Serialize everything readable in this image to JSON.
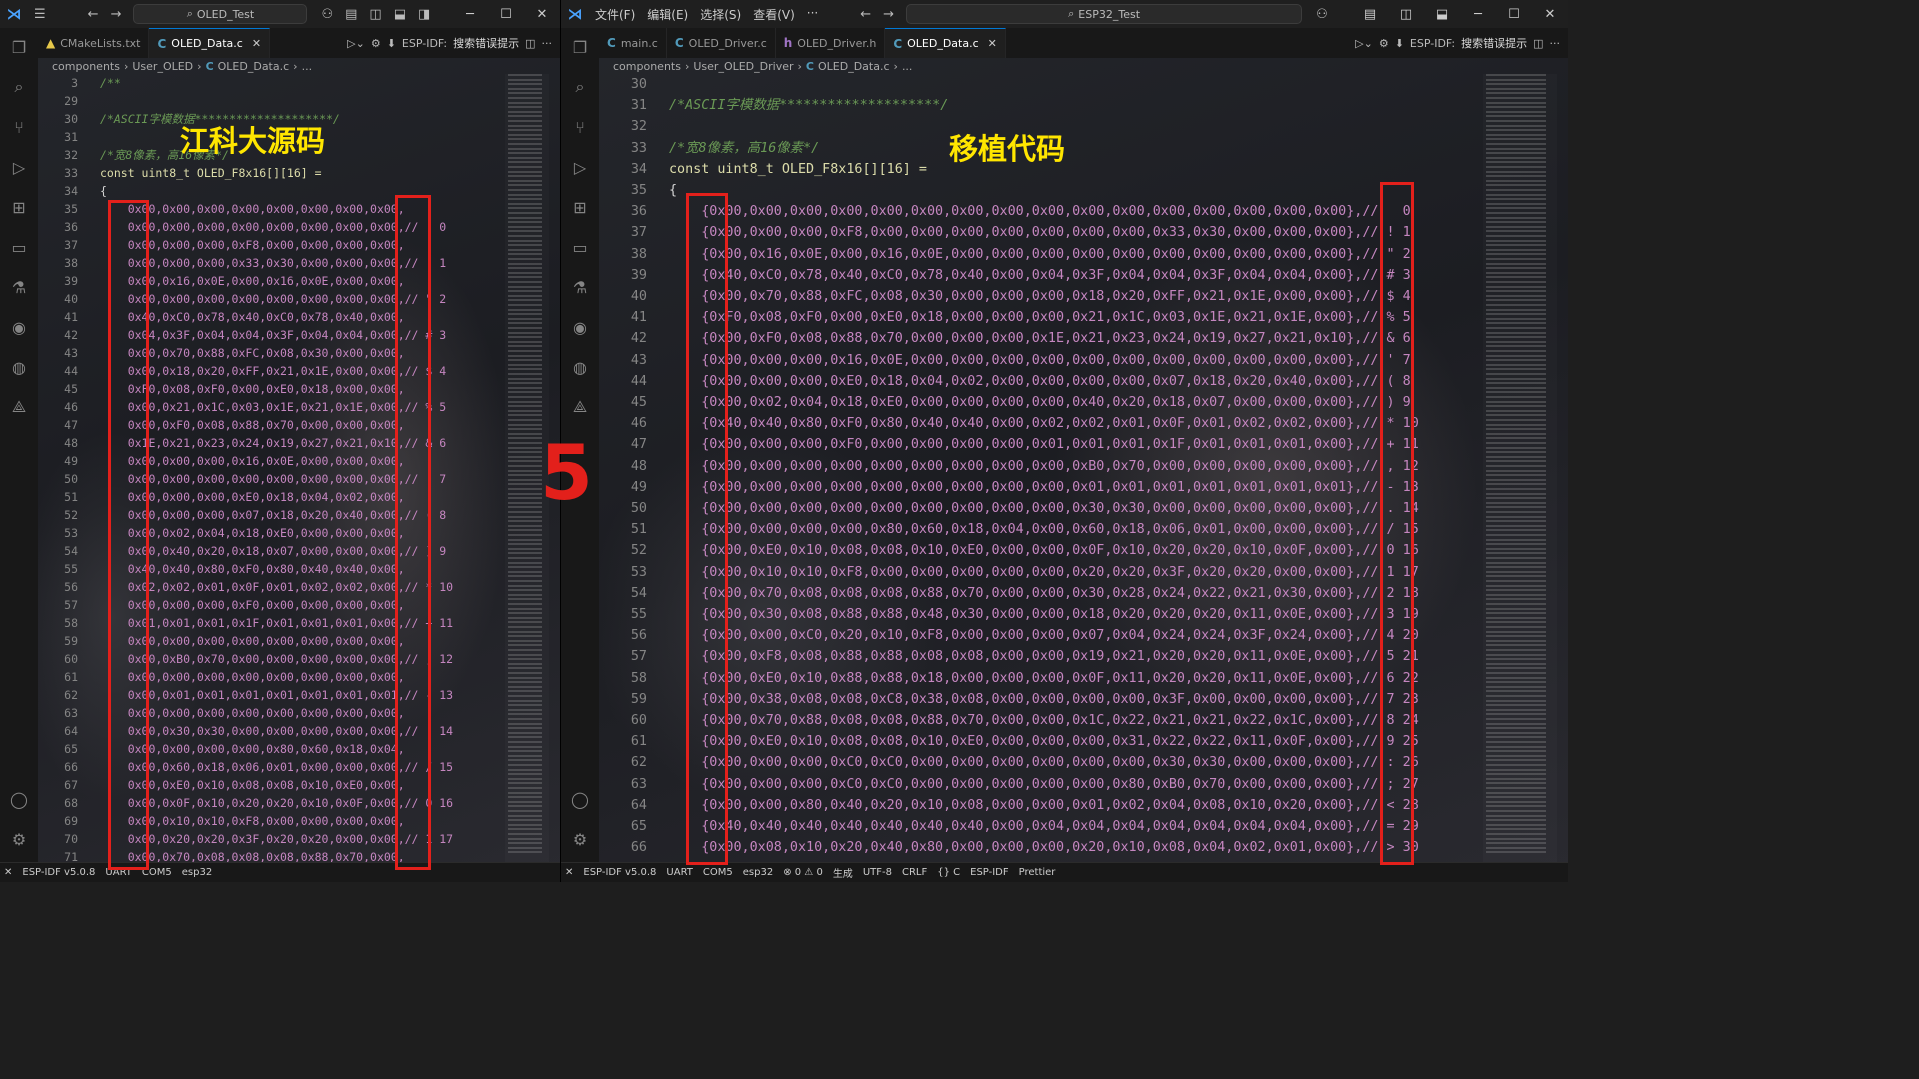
{
  "left": {
    "search": "OLED_Test",
    "tabs": [
      {
        "label": "CMakeLists.txt",
        "icon": "cmake-icon"
      },
      {
        "label": "OLED_Data.c",
        "icon": "c-file-icon",
        "active": true
      }
    ],
    "espidf": "ESP-IDF:",
    "espidf_hint": "搜索错误提示",
    "crumb": [
      "components",
      "User_OLED",
      "OLED_Data.c",
      "..."
    ],
    "annotation": "江科大源码",
    "status": [
      "ESP-IDF v5.0.8",
      "UART",
      "COM5",
      "esp32"
    ],
    "lines": [
      {
        "n": "3",
        "t": "/**",
        "k": "cm"
      },
      {
        "n": "29",
        "t": "",
        "k": "pl"
      },
      {
        "n": "30",
        "t": "/*ASCII字模数据********************/",
        "k": "cm"
      },
      {
        "n": "31",
        "t": "",
        "k": "pl"
      },
      {
        "n": "32",
        "t": "/*宽8像素，高16像素*/",
        "k": "cm"
      },
      {
        "n": "33",
        "t": "const uint8_t OLED_F8x16[][16] =",
        "k": "decl"
      },
      {
        "n": "34",
        "t": "{",
        "k": "pl"
      },
      {
        "n": "35",
        "t": "    0x00,0x00,0x00,0x00,0x00,0x00,0x00,0x00,",
        "k": "hx"
      },
      {
        "n": "36",
        "t": "    0x00,0x00,0x00,0x00,0x00,0x00,0x00,0x00,//   0",
        "k": "hx"
      },
      {
        "n": "37",
        "t": "    0x00,0x00,0x00,0xF8,0x00,0x00,0x00,0x00,",
        "k": "hx"
      },
      {
        "n": "38",
        "t": "    0x00,0x00,0x00,0x33,0x30,0x00,0x00,0x00,// ! 1",
        "k": "hx"
      },
      {
        "n": "39",
        "t": "    0x00,0x16,0x0E,0x00,0x16,0x0E,0x00,0x00,",
        "k": "hx"
      },
      {
        "n": "40",
        "t": "    0x00,0x00,0x00,0x00,0x00,0x00,0x00,0x00,// \" 2",
        "k": "hx"
      },
      {
        "n": "41",
        "t": "    0x40,0xC0,0x78,0x40,0xC0,0x78,0x40,0x00,",
        "k": "hx"
      },
      {
        "n": "42",
        "t": "    0x04,0x3F,0x04,0x04,0x3F,0x04,0x04,0x00,// # 3",
        "k": "hx"
      },
      {
        "n": "43",
        "t": "    0x00,0x70,0x88,0xFC,0x08,0x30,0x00,0x00,",
        "k": "hx"
      },
      {
        "n": "44",
        "t": "    0x00,0x18,0x20,0xFF,0x21,0x1E,0x00,0x00,// $ 4",
        "k": "hx"
      },
      {
        "n": "45",
        "t": "    0xF0,0x08,0xF0,0x00,0xE0,0x18,0x00,0x00,",
        "k": "hx"
      },
      {
        "n": "46",
        "t": "    0x00,0x21,0x1C,0x03,0x1E,0x21,0x1E,0x00,// % 5",
        "k": "hx"
      },
      {
        "n": "47",
        "t": "    0x00,0xF0,0x08,0x88,0x70,0x00,0x00,0x00,",
        "k": "hx"
      },
      {
        "n": "48",
        "t": "    0x1E,0x21,0x23,0x24,0x19,0x27,0x21,0x10,// & 6",
        "k": "hx"
      },
      {
        "n": "49",
        "t": "    0x00,0x00,0x00,0x16,0x0E,0x00,0x00,0x00,",
        "k": "hx"
      },
      {
        "n": "50",
        "t": "    0x00,0x00,0x00,0x00,0x00,0x00,0x00,0x00,// ' 7",
        "k": "hx"
      },
      {
        "n": "51",
        "t": "    0x00,0x00,0x00,0xE0,0x18,0x04,0x02,0x00,",
        "k": "hx"
      },
      {
        "n": "52",
        "t": "    0x00,0x00,0x00,0x07,0x18,0x20,0x40,0x00,// ( 8",
        "k": "hx"
      },
      {
        "n": "53",
        "t": "    0x00,0x02,0x04,0x18,0xE0,0x00,0x00,0x00,",
        "k": "hx"
      },
      {
        "n": "54",
        "t": "    0x00,0x40,0x20,0x18,0x07,0x00,0x00,0x00,// ) 9",
        "k": "hx"
      },
      {
        "n": "55",
        "t": "    0x40,0x40,0x80,0xF0,0x80,0x40,0x40,0x00,",
        "k": "hx"
      },
      {
        "n": "56",
        "t": "    0x02,0x02,0x01,0x0F,0x01,0x02,0x02,0x00,// * 10",
        "k": "hx"
      },
      {
        "n": "57",
        "t": "    0x00,0x00,0x00,0xF0,0x00,0x00,0x00,0x00,",
        "k": "hx"
      },
      {
        "n": "58",
        "t": "    0x01,0x01,0x01,0x1F,0x01,0x01,0x01,0x00,// + 11",
        "k": "hx"
      },
      {
        "n": "59",
        "t": "    0x00,0x00,0x00,0x00,0x00,0x00,0x00,0x00,",
        "k": "hx"
      },
      {
        "n": "60",
        "t": "    0x00,0xB0,0x70,0x00,0x00,0x00,0x00,0x00,// , 12",
        "k": "hx"
      },
      {
        "n": "61",
        "t": "    0x00,0x00,0x00,0x00,0x00,0x00,0x00,0x00,",
        "k": "hx"
      },
      {
        "n": "62",
        "t": "    0x00,0x01,0x01,0x01,0x01,0x01,0x01,0x01,// - 13",
        "k": "hx"
      },
      {
        "n": "63",
        "t": "    0x00,0x00,0x00,0x00,0x00,0x00,0x00,0x00,",
        "k": "hx"
      },
      {
        "n": "64",
        "t": "    0x00,0x30,0x30,0x00,0x00,0x00,0x00,0x00,// . 14",
        "k": "hx"
      },
      {
        "n": "65",
        "t": "    0x00,0x00,0x00,0x00,0x80,0x60,0x18,0x04,",
        "k": "hx"
      },
      {
        "n": "66",
        "t": "    0x00,0x60,0x18,0x06,0x01,0x00,0x00,0x00,// / 15",
        "k": "hx"
      },
      {
        "n": "67",
        "t": "    0x00,0xE0,0x10,0x08,0x08,0x10,0xE0,0x00,",
        "k": "hx"
      },
      {
        "n": "68",
        "t": "    0x00,0x0F,0x10,0x20,0x20,0x10,0x0F,0x00,// 0 16",
        "k": "hx"
      },
      {
        "n": "69",
        "t": "    0x00,0x10,0x10,0xF8,0x00,0x00,0x00,0x00,",
        "k": "hx"
      },
      {
        "n": "70",
        "t": "    0x00,0x20,0x20,0x3F,0x20,0x20,0x00,0x00,// 1 17",
        "k": "hx"
      },
      {
        "n": "71",
        "t": "    0x00,0x70,0x08,0x08,0x08,0x88,0x70,0x00,",
        "k": "hx"
      }
    ]
  },
  "right": {
    "menus": [
      "文件(F)",
      "编辑(E)",
      "选择(S)",
      "查看(V)",
      "···"
    ],
    "search": "ESP32_Test",
    "tabs": [
      {
        "label": "main.c",
        "icon": "c-file-icon"
      },
      {
        "label": "OLED_Driver.c",
        "icon": "c-file-icon"
      },
      {
        "label": "OLED_Driver.h",
        "icon": "h-file-icon"
      },
      {
        "label": "OLED_Data.c",
        "icon": "c-file-icon",
        "active": true
      }
    ],
    "espidf": "ESP-IDF:",
    "espidf_hint": "搜索错误提示",
    "crumb": [
      "components",
      "User_OLED_Driver",
      "OLED_Data.c",
      "..."
    ],
    "annotation": "移植代码",
    "status": [
      "ESP-IDF v5.0.8",
      "UART",
      "COM5",
      "esp32",
      "⊗ 0 ⚠ 0",
      "生成",
      "UTF-8",
      "CRLF",
      "{} C",
      "ESP-IDF",
      "Prettier"
    ],
    "lines": [
      {
        "n": "30",
        "t": "",
        "k": "pl"
      },
      {
        "n": "31",
        "t": "/*ASCII字模数据********************/",
        "k": "cm"
      },
      {
        "n": "32",
        "t": "",
        "k": "pl"
      },
      {
        "n": "33",
        "t": "/*宽8像素，高16像素*/",
        "k": "cm"
      },
      {
        "n": "34",
        "t": "const uint8_t OLED_F8x16[][16] =",
        "k": "decl"
      },
      {
        "n": "35",
        "t": "{",
        "k": "pl"
      },
      {
        "n": "36",
        "t": "    {0x00,0x00,0x00,0x00,0x00,0x00,0x00,0x00,0x00,0x00,0x00,0x00,0x00,0x00,0x00,0x00},//   0",
        "k": "hx"
      },
      {
        "n": "37",
        "t": "    {0x00,0x00,0x00,0xF8,0x00,0x00,0x00,0x00,0x00,0x00,0x00,0x33,0x30,0x00,0x00,0x00},// ! 1",
        "k": "hx"
      },
      {
        "n": "38",
        "t": "    {0x00,0x16,0x0E,0x00,0x16,0x0E,0x00,0x00,0x00,0x00,0x00,0x00,0x00,0x00,0x00,0x00},// \" 2",
        "k": "hx"
      },
      {
        "n": "39",
        "t": "    {0x40,0xC0,0x78,0x40,0xC0,0x78,0x40,0x00,0x04,0x3F,0x04,0x04,0x3F,0x04,0x04,0x00},// # 3",
        "k": "hx"
      },
      {
        "n": "40",
        "t": "    {0x00,0x70,0x88,0xFC,0x08,0x30,0x00,0x00,0x00,0x18,0x20,0xFF,0x21,0x1E,0x00,0x00},// $ 4",
        "k": "hx"
      },
      {
        "n": "41",
        "t": "    {0xF0,0x08,0xF0,0x00,0xE0,0x18,0x00,0x00,0x00,0x21,0x1C,0x03,0x1E,0x21,0x1E,0x00},// % 5",
        "k": "hx"
      },
      {
        "n": "42",
        "t": "    {0x00,0xF0,0x08,0x88,0x70,0x00,0x00,0x00,0x1E,0x21,0x23,0x24,0x19,0x27,0x21,0x10},// & 6",
        "k": "hx"
      },
      {
        "n": "43",
        "t": "    {0x00,0x00,0x00,0x16,0x0E,0x00,0x00,0x00,0x00,0x00,0x00,0x00,0x00,0x00,0x00,0x00},// ' 7",
        "k": "hx"
      },
      {
        "n": "44",
        "t": "    {0x00,0x00,0x00,0xE0,0x18,0x04,0x02,0x00,0x00,0x00,0x00,0x07,0x18,0x20,0x40,0x00},// ( 8",
        "k": "hx"
      },
      {
        "n": "45",
        "t": "    {0x00,0x02,0x04,0x18,0xE0,0x00,0x00,0x00,0x00,0x40,0x20,0x18,0x07,0x00,0x00,0x00},// ) 9",
        "k": "hx"
      },
      {
        "n": "46",
        "t": "    {0x40,0x40,0x80,0xF0,0x80,0x40,0x40,0x00,0x02,0x02,0x01,0x0F,0x01,0x02,0x02,0x00},// * 10",
        "k": "hx"
      },
      {
        "n": "47",
        "t": "    {0x00,0x00,0x00,0xF0,0x00,0x00,0x00,0x00,0x01,0x01,0x01,0x1F,0x01,0x01,0x01,0x00},// + 11",
        "k": "hx"
      },
      {
        "n": "48",
        "t": "    {0x00,0x00,0x00,0x00,0x00,0x00,0x00,0x00,0x00,0xB0,0x70,0x00,0x00,0x00,0x00,0x00},// , 12",
        "k": "hx"
      },
      {
        "n": "49",
        "t": "    {0x00,0x00,0x00,0x00,0x00,0x00,0x00,0x00,0x00,0x01,0x01,0x01,0x01,0x01,0x01,0x01},// - 13",
        "k": "hx"
      },
      {
        "n": "50",
        "t": "    {0x00,0x00,0x00,0x00,0x00,0x00,0x00,0x00,0x00,0x30,0x30,0x00,0x00,0x00,0x00,0x00},// . 14",
        "k": "hx"
      },
      {
        "n": "51",
        "t": "    {0x00,0x00,0x00,0x00,0x80,0x60,0x18,0x04,0x00,0x60,0x18,0x06,0x01,0x00,0x00,0x00},// / 15",
        "k": "hx"
      },
      {
        "n": "52",
        "t": "    {0x00,0xE0,0x10,0x08,0x08,0x10,0xE0,0x00,0x00,0x0F,0x10,0x20,0x20,0x10,0x0F,0x00},// 0 16",
        "k": "hx"
      },
      {
        "n": "53",
        "t": "    {0x00,0x10,0x10,0xF8,0x00,0x00,0x00,0x00,0x00,0x20,0x20,0x3F,0x20,0x20,0x00,0x00},// 1 17",
        "k": "hx"
      },
      {
        "n": "54",
        "t": "    {0x00,0x70,0x08,0x08,0x08,0x88,0x70,0x00,0x00,0x30,0x28,0x24,0x22,0x21,0x30,0x00},// 2 18",
        "k": "hx"
      },
      {
        "n": "55",
        "t": "    {0x00,0x30,0x08,0x88,0x88,0x48,0x30,0x00,0x00,0x18,0x20,0x20,0x20,0x11,0x0E,0x00},// 3 19",
        "k": "hx"
      },
      {
        "n": "56",
        "t": "    {0x00,0x00,0xC0,0x20,0x10,0xF8,0x00,0x00,0x00,0x07,0x04,0x24,0x24,0x3F,0x24,0x00},// 4 20",
        "k": "hx"
      },
      {
        "n": "57",
        "t": "    {0x00,0xF8,0x08,0x88,0x88,0x08,0x08,0x00,0x00,0x19,0x21,0x20,0x20,0x11,0x0E,0x00},// 5 21",
        "k": "hx"
      },
      {
        "n": "58",
        "t": "    {0x00,0xE0,0x10,0x88,0x88,0x18,0x00,0x00,0x00,0x0F,0x11,0x20,0x20,0x11,0x0E,0x00},// 6 22",
        "k": "hx"
      },
      {
        "n": "59",
        "t": "    {0x00,0x38,0x08,0x08,0xC8,0x38,0x08,0x00,0x00,0x00,0x00,0x3F,0x00,0x00,0x00,0x00},// 7 23",
        "k": "hx"
      },
      {
        "n": "60",
        "t": "    {0x00,0x70,0x88,0x08,0x08,0x88,0x70,0x00,0x00,0x1C,0x22,0x21,0x21,0x22,0x1C,0x00},// 8 24",
        "k": "hx"
      },
      {
        "n": "61",
        "t": "    {0x00,0xE0,0x10,0x08,0x08,0x10,0xE0,0x00,0x00,0x00,0x31,0x22,0x22,0x11,0x0F,0x00},// 9 25",
        "k": "hx"
      },
      {
        "n": "62",
        "t": "    {0x00,0x00,0x00,0xC0,0xC0,0x00,0x00,0x00,0x00,0x00,0x00,0x30,0x30,0x00,0x00,0x00},// : 26",
        "k": "hx"
      },
      {
        "n": "63",
        "t": "    {0x00,0x00,0x00,0xC0,0xC0,0x00,0x00,0x00,0x00,0x00,0x80,0xB0,0x70,0x00,0x00,0x00},// ; 27",
        "k": "hx"
      },
      {
        "n": "64",
        "t": "    {0x00,0x00,0x80,0x40,0x20,0x10,0x08,0x00,0x00,0x01,0x02,0x04,0x08,0x10,0x20,0x00},// < 28",
        "k": "hx"
      },
      {
        "n": "65",
        "t": "    {0x40,0x40,0x40,0x40,0x40,0x40,0x40,0x00,0x04,0x04,0x04,0x04,0x04,0x04,0x04,0x00},// = 29",
        "k": "hx"
      },
      {
        "n": "66",
        "t": "    {0x00,0x08,0x10,0x20,0x40,0x80,0x00,0x00,0x00,0x20,0x10,0x08,0x04,0x02,0x01,0x00},// > 30",
        "k": "hx"
      }
    ]
  },
  "marker": "5"
}
